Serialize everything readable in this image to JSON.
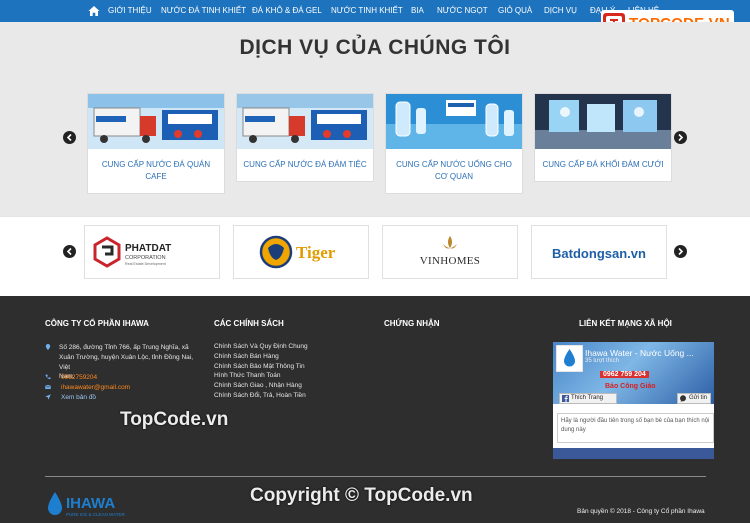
{
  "nav": {
    "items": [
      "GIỚI THIỆU",
      "NƯỚC ĐÁ TINH KHIẾT",
      "ĐÁ KHÔ & ĐÁ GEL",
      "NƯỚC TINH KHIẾT",
      "BIA",
      "NƯỚC NGỌT",
      "GIỎ QUÀ",
      "DỊCH VỤ",
      "ĐẠI LÝ",
      "LIÊN HỆ"
    ]
  },
  "brand": {
    "text": "TOPCODE.VN"
  },
  "services": {
    "title": "DỊCH VỤ CỦA CHÚNG TÔI",
    "cards": [
      {
        "caption": "CUNG CẤP NƯỚC ĐÁ QUÁN CAFE"
      },
      {
        "caption": "CUNG CẤP NƯỚC ĐÁ ĐÁM TIỆC"
      },
      {
        "caption": "CUNG CẤP NƯỚC UỐNG CHO CƠ QUAN"
      },
      {
        "caption": "CUNG CẤP ĐÁ KHỐI ĐÁM CƯỚI"
      }
    ]
  },
  "partners": [
    {
      "name": "PHATDAT",
      "sub": "CORPORATION",
      "tag": "Real Estate Development"
    },
    {
      "name": "Tiger"
    },
    {
      "name": "VINHOMES"
    },
    {
      "name": "Batdongsan.vn"
    }
  ],
  "footer": {
    "company": {
      "heading": "CÔNG TY CỔ PHẦN IHAWA",
      "address": [
        "Số 286, đường Tỉnh 766, ấp Trung Nghĩa, xã",
        "Xuân Trường, huyện Xuân Lộc, tỉnh Đồng Nai, Việt",
        "Nam."
      ],
      "phone": "0962759204",
      "email": "ihawawater@gmail.com",
      "map": "Xem bản đồ"
    },
    "policies": {
      "heading": "CÁC CHÍNH SÁCH",
      "items": [
        "Chính Sách Và Quy Định Chung",
        "Chính Sách Bán Hàng",
        "Chính Sách Bảo Mật Thông Tin",
        "Hình Thức Thanh Toán",
        "Chính Sách Giao , Nhận Hàng",
        "Chính Sách Đổi, Trả, Hoàn Tiền"
      ]
    },
    "certs": {
      "heading": "CHỨNG NHẬN"
    },
    "social": {
      "heading": "LIÊN KẾT MẠNG XÃ HỘI",
      "page_title": "Ihawa Water - Nước Uống ...",
      "likes": "35 lượt thích",
      "phone": "0962 759 204",
      "banner": "Báo Công Giáo",
      "follow": "Thích Trang",
      "send": "Gửi tin",
      "message": "Hãy là người đầu tiên trong số bạn bè của bạn thích nội dung này"
    },
    "copyright": "Bản quyền © 2018 - Công ty Cổ phần Ihawa"
  },
  "watermarks": {
    "center": "TopCode.vn",
    "bottom": "Copyright © TopCode.vn"
  },
  "colors": {
    "nav": "#1e73be",
    "footer": "#2e2e2e",
    "link": "#2b6fb5",
    "accent": "#ff8a1e"
  }
}
